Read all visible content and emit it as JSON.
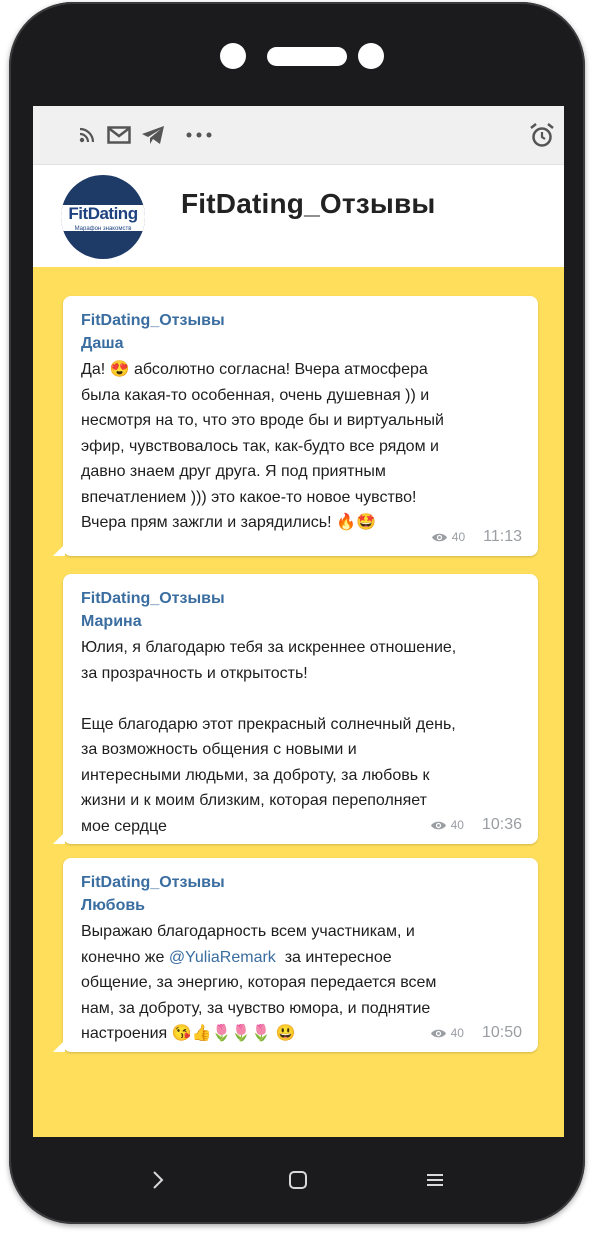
{
  "channel": {
    "title": "FitDating_Отзывы",
    "logo_text": "FitDating",
    "logo_subtitle": "Марафон знакомств"
  },
  "statusbar": {
    "icons": [
      "rss-icon",
      "mail-icon",
      "telegram-icon",
      "more-icon",
      "alarm-icon"
    ]
  },
  "messages": [
    {
      "channel": "FitDating_Отзывы",
      "author": "Даша",
      "text_html_parts": [
        "Да! 😍 абсолютно согласна! Вчера атмосфера\nбыла какая-то особенная, очень душевная )) и\nнесмотря на то, что это вроде бы и виртуальный\nэфир, чувствовалось так, как-будто все рядом и\nдавно знаем друг друга. Я под приятным\nвпечатлением ))) это какое-то новое чувство!\nВчера прям зажгли и зарядились! 🔥🤩"
      ],
      "views": "40",
      "time": "11:13"
    },
    {
      "channel": "FitDating_Отзывы",
      "author": "Марина",
      "text_html_parts": [
        "Юлия, я благодарю тебя за искреннее отношение,\nза прозрачность и открытость!\n\nЕще благодарю этот прекрасный солнечный день,\nза возможность общения с новыми и\nинтересными людьми, за доброту, за любовь к\nжизни и к моим близким, которая переполняет\nмое сердце"
      ],
      "views": "40",
      "time": "10:36"
    },
    {
      "channel": "FitDating_Отзывы",
      "author": "Любовь",
      "text_before_link": "Выражаю благодарность всем участникам, и\nконечно же ",
      "link": "@YuliaRemark",
      "text_after_link": "  за интересное\nобщение, за энергию, которая передается всем\nнам, за доброту, за чувство юмора, и поднятие\nнастроения 😘👍🌷🌷🌷 😃",
      "views": "40",
      "time": "10:50"
    }
  ],
  "navbar": {
    "icons": [
      "back-icon",
      "home-icon",
      "menu-icon"
    ]
  }
}
